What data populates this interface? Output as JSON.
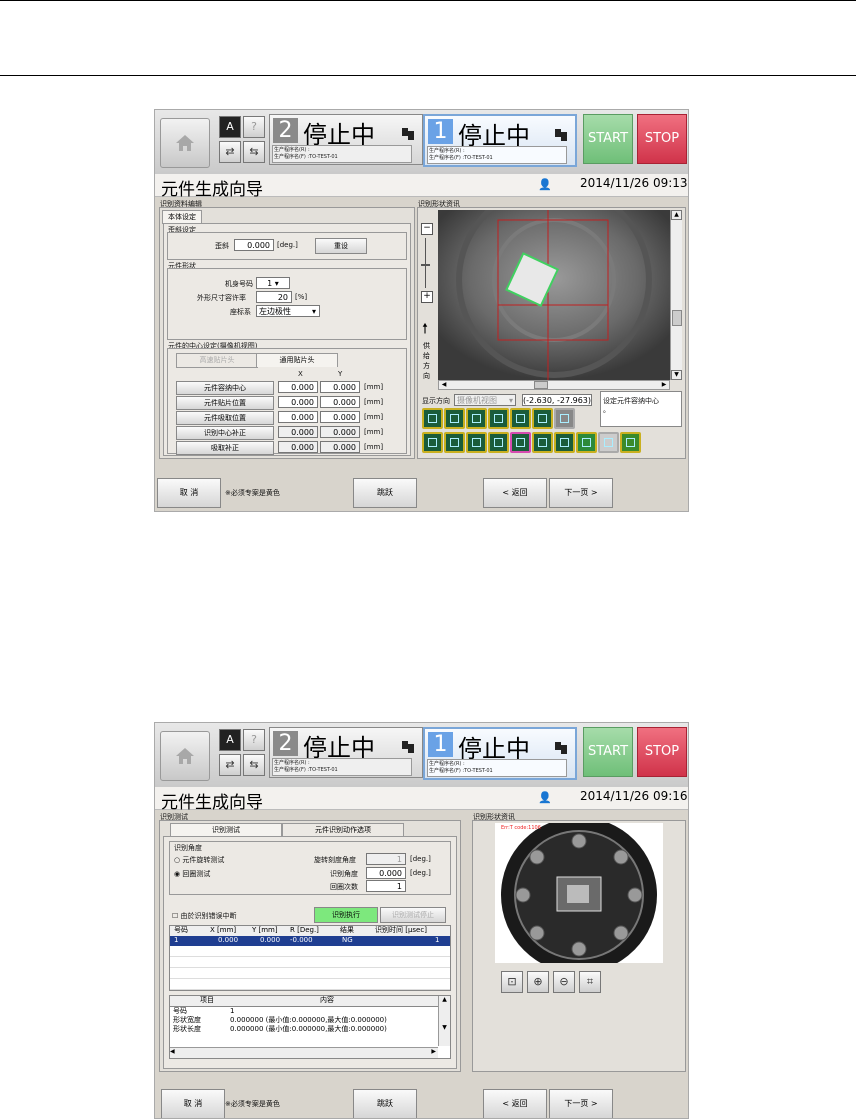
{
  "shared": {
    "mode_status": "停止中",
    "station2_number": "2",
    "station1_number": "1",
    "prog_r": "生产程序名(R) :",
    "prog_f": "生产程序名(F) :TO-TEST-01",
    "start": "START",
    "stop": "STOP",
    "title": "元件生成向导",
    "cancel": "取  消",
    "note": "※必须专案是黄色",
    "skip": "跳跃",
    "back": "< 返回",
    "next": "下一页 >",
    "icon_a": "A",
    "icon_q": "?"
  },
  "screen1": {
    "datetime": "2014/11/26 09:13",
    "left_group": "识别资料编辑",
    "tab_body": "本体设定",
    "tilt_group": "歪斜设定",
    "tilt_label": "歪斜",
    "tilt_value": "0.000",
    "tilt_unit": "[deg.]",
    "reset": "重设",
    "shape_group": "元件形状",
    "body_no_label": "机身号码",
    "body_no_value": "1",
    "tolerance_label": "外形尺寸容许率",
    "tolerance_value": "20",
    "tolerance_unit": "[%]",
    "coord_label": "座标系",
    "coord_value": "左边极性",
    "center_group": "元件的中心设定(摄像机视图)",
    "tab_head_dis": "高速贴片头",
    "tab_head": "通用贴片头",
    "col_x": "X",
    "col_y": "Y",
    "rows": [
      {
        "label": "元件容纳中心",
        "x": "0.000",
        "y": "0.000",
        "unit": "[mm]"
      },
      {
        "label": "元件贴片位置",
        "x": "0.000",
        "y": "0.000",
        "unit": "[mm]"
      },
      {
        "label": "元件吸取位置",
        "x": "0.000",
        "y": "0.000",
        "unit": "[mm]"
      },
      {
        "label": "识别中心补正",
        "x": "0.000",
        "y": "0.000",
        "unit": "[mm]"
      },
      {
        "label": "吸取补正",
        "x": "0.000",
        "y": "0.000",
        "unit": "[mm]"
      }
    ],
    "right_group": "识别形状资讯",
    "supply_dir": "供给方向",
    "display_dir_label": "显示方向",
    "display_dir_value": "摄像机视图",
    "coord_readout": "(-2.630, -27.963)",
    "set_center": "设定元件容纳中心",
    "dot": "。"
  },
  "screen2": {
    "datetime": "2014/11/26 09:16",
    "left_group": "识别测试",
    "tab_test": "识别测试",
    "tab_options": "元件识别动作选项",
    "angle_group": "识别角度",
    "radio_rotate": "元件旋转测试",
    "radio_repeat": "回圈测试",
    "rot_label": "旋转刻度角度",
    "rot_value": "1",
    "rot_unit": "[deg.]",
    "angle_label": "识别角度",
    "angle_value": "0.000",
    "angle_unit": "[deg.]",
    "loop_label": "回圈次数",
    "loop_value": "1",
    "interrupt_check": "由於识别错误中断",
    "exec": "识别执行",
    "stop_test": "识别测试停止",
    "table_headers": [
      "号码",
      "X [mm]",
      "Y [mm]",
      "R [Deg.]",
      "结果",
      "识别时间 [µsec]"
    ],
    "table_row": [
      "1",
      "0.000",
      "0.000",
      "-0.000",
      "NG",
      "1"
    ],
    "detail_headers": [
      "项目",
      "内容"
    ],
    "details": [
      {
        "item": "号码",
        "content": "1"
      },
      {
        "item": "形状宽度",
        "content": "0.000000 (最小值:0.000000,最大值:0.000000)"
      },
      {
        "item": "形状长度",
        "content": "0.000000 (最小值:0.000000,最大值:0.000000)"
      }
    ],
    "right_group": "识别形状资讯",
    "overlay_text": "Err:T code:1106"
  }
}
